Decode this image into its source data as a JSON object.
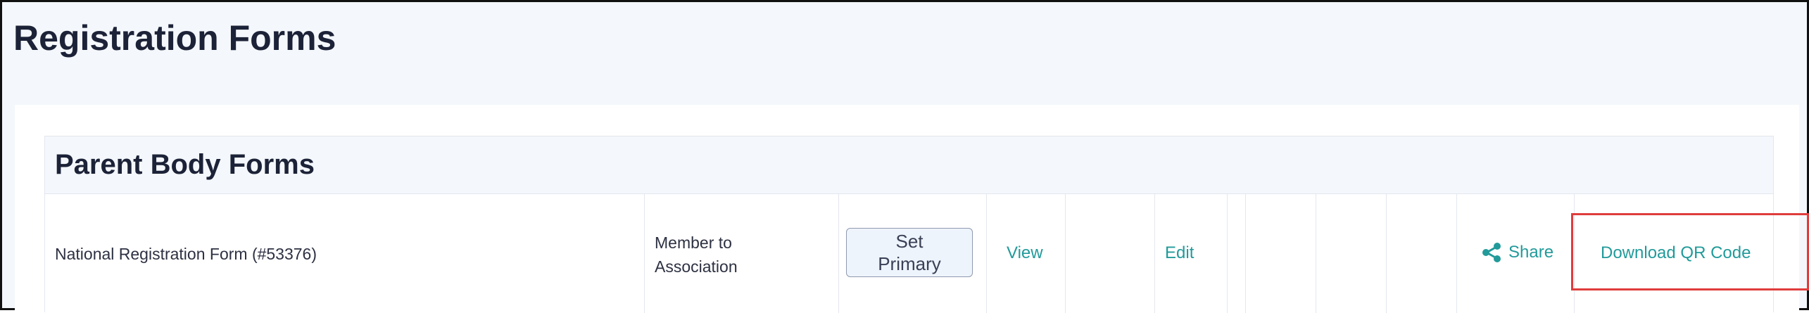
{
  "page": {
    "title": "Registration Forms"
  },
  "section": {
    "title": "Parent Body Forms"
  },
  "form_row": {
    "name": "National Registration Form (#53376)",
    "type_line1": "Member to",
    "type_line2": "Association",
    "set_primary_line1": "Set",
    "set_primary_line2": "Primary",
    "view_label": "View",
    "edit_label": "Edit",
    "share_label": "Share",
    "download_qr_label": "Download QR Code"
  },
  "colors": {
    "accent_link": "#229a9a",
    "title_text": "#1c2237",
    "highlight_box": "#e03c3c",
    "header_bg": "#f4f7fb"
  },
  "icons": {
    "share": "share-icon"
  }
}
